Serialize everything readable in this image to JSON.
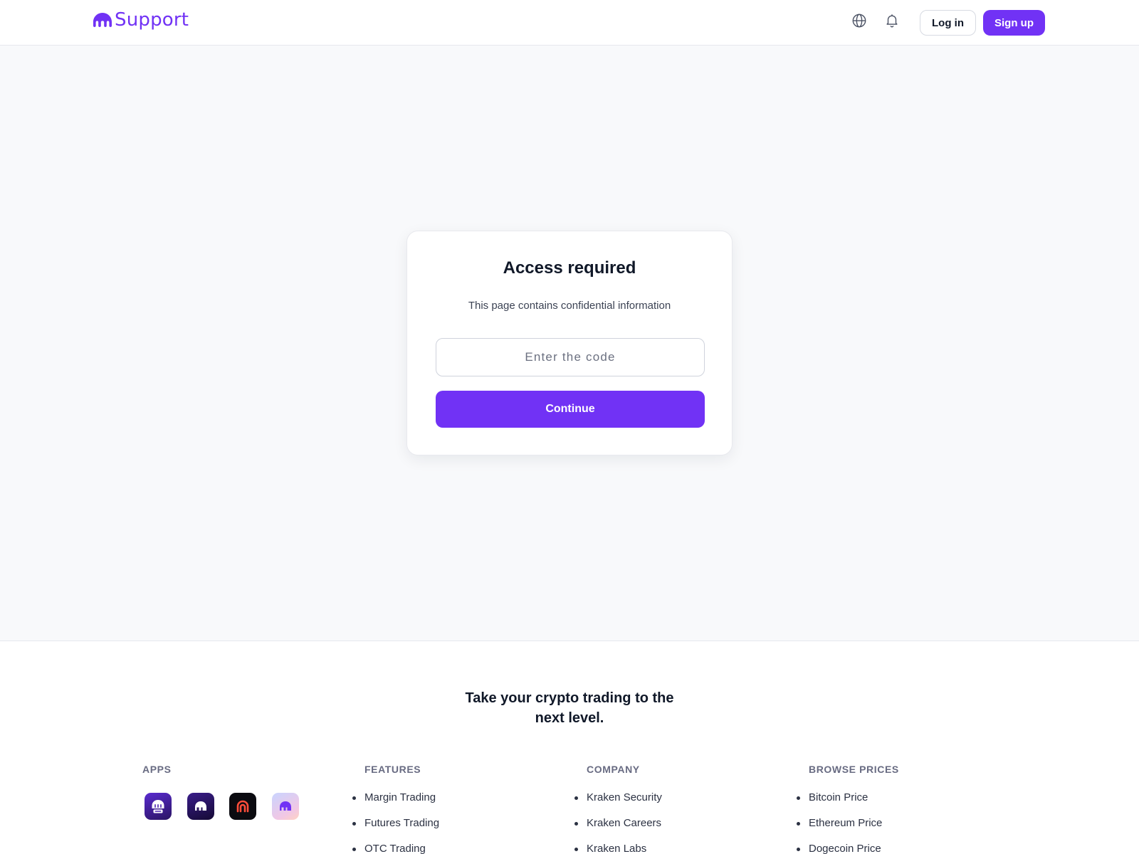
{
  "header": {
    "brand_text": "Support",
    "login_label": "Log in",
    "signup_label": "Sign up",
    "icons": [
      "kraken-logo-icon",
      "globe-icon",
      "bell-icon"
    ],
    "accent_color": "#7132f5"
  },
  "access_card": {
    "title": "Access required",
    "subtitle": "This page contains confidential information",
    "code_placeholder": "Enter the code",
    "code_value": "",
    "continue_label": "Continue"
  },
  "footer": {
    "tagline_line1": "Take your crypto trading to the",
    "tagline_line2": "next level.",
    "apps": {
      "heading": "APPS",
      "icons": [
        "kraken-pro-app-icon",
        "kraken-app-icon",
        "kraken-futures-app-icon",
        "kraken-wallet-app-icon"
      ]
    },
    "features": {
      "heading": "FEATURES",
      "links": [
        "Margin Trading",
        "Futures Trading",
        "OTC Trading"
      ]
    },
    "company": {
      "heading": "COMPANY",
      "links": [
        "Kraken Security",
        "Kraken Careers",
        "Kraken Labs"
      ]
    },
    "browse_prices": {
      "heading": "BROWSE PRICES",
      "links": [
        "Bitcoin Price",
        "Ethereum Price",
        "Dogecoin Price"
      ]
    }
  }
}
